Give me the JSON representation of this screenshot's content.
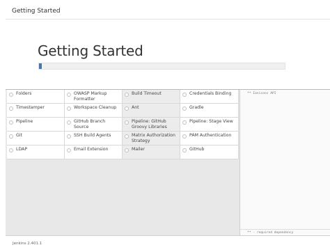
{
  "window": {
    "title": "Getting Started"
  },
  "hero": {
    "title": "Getting Started",
    "progress": 0.01
  },
  "plugins": [
    {
      "label": "Folders",
      "state": "lit"
    },
    {
      "label": "OWASP Markup Formatter",
      "state": "lit"
    },
    {
      "label": "Build Timeout",
      "state": "dim"
    },
    {
      "label": "Credentials Binding",
      "state": "lit"
    },
    {
      "label": "Timestamper",
      "state": "lit"
    },
    {
      "label": "Workspace Cleanup",
      "state": "lit"
    },
    {
      "label": "Ant",
      "state": "dim"
    },
    {
      "label": "Gradle",
      "state": "lit"
    },
    {
      "label": "Pipeline",
      "state": "lit"
    },
    {
      "label": "GitHub Branch Source",
      "state": "lit"
    },
    {
      "label": "Pipeline: GitHub Groovy Libraries",
      "state": "dim"
    },
    {
      "label": "Pipeline: Stage View",
      "state": "lit"
    },
    {
      "label": "Git",
      "state": "lit"
    },
    {
      "label": "SSH Build Agents",
      "state": "lit"
    },
    {
      "label": "Matrix Authorization Strategy",
      "state": "dim"
    },
    {
      "label": "PAM Authentication",
      "state": "lit"
    },
    {
      "label": "LDAP",
      "state": "lit"
    },
    {
      "label": "Email Extension",
      "state": "lit"
    },
    {
      "label": "Mailer",
      "state": "dim"
    },
    {
      "label": "GitHub",
      "state": "lit"
    }
  ],
  "log": {
    "line": "** Ionicons API",
    "footer": "** - required dependency"
  },
  "footer": {
    "version": "Jenkins 2.401.1"
  }
}
